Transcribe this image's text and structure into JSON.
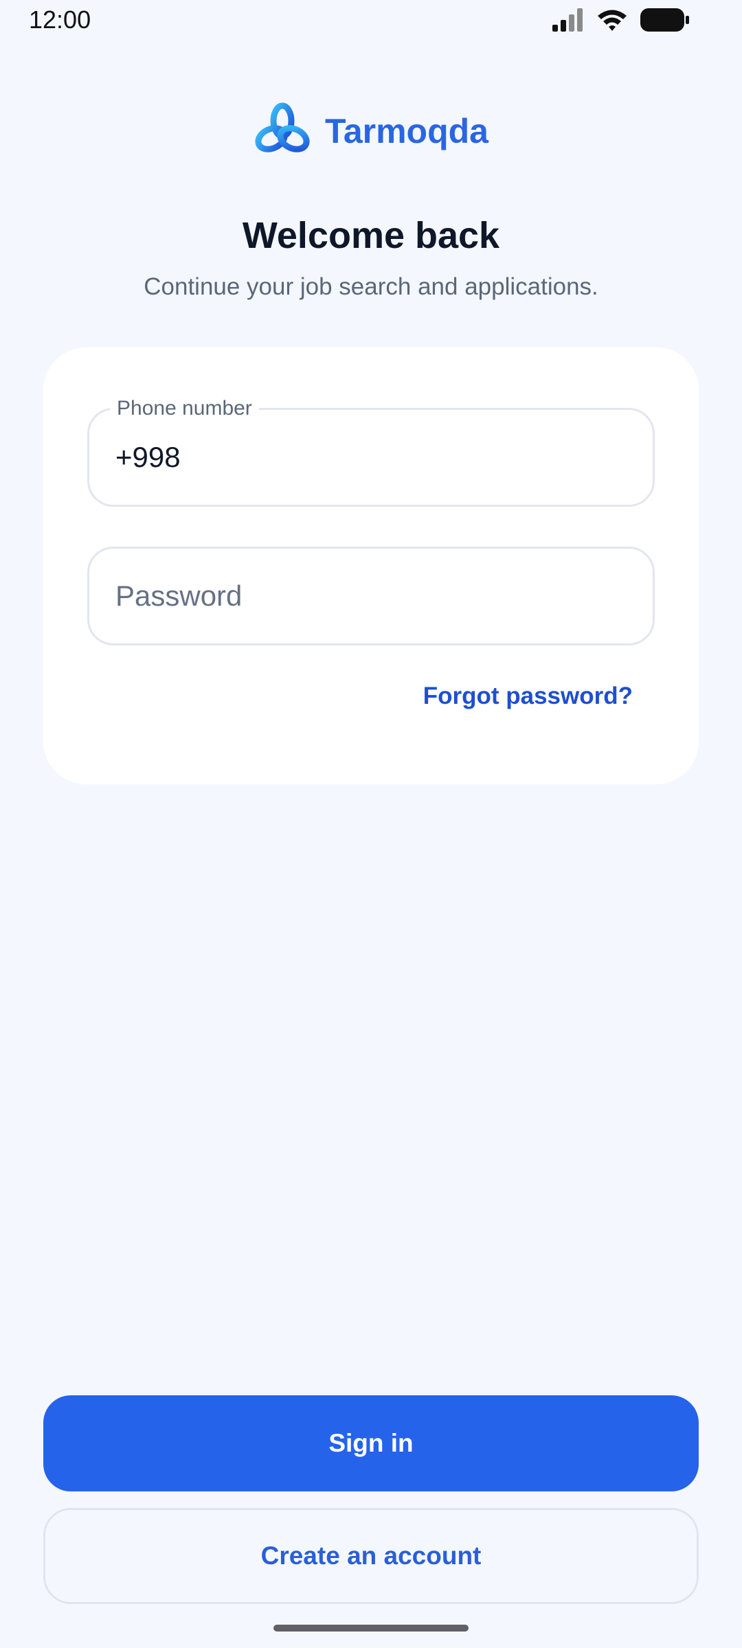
{
  "status_bar": {
    "time": "12:00",
    "icons": [
      "signal-icon",
      "wifi-icon",
      "battery-icon"
    ]
  },
  "brand": {
    "name": "Tarmoqda",
    "logo_icon": "trefoil-logo-icon",
    "color": "#2a66e3"
  },
  "header": {
    "title": "Welcome back",
    "subtitle": "Continue your job search and applications."
  },
  "form": {
    "phone": {
      "label": "Phone number",
      "value": "+998"
    },
    "password": {
      "placeholder": "Password",
      "value": ""
    },
    "forgot_label": "Forgot password?"
  },
  "actions": {
    "sign_in_label": "Sign in",
    "create_account_label": "Create an account"
  },
  "colors": {
    "background": "#f4f8fe",
    "primary": "#2563eb",
    "link": "#1f4fcf"
  }
}
